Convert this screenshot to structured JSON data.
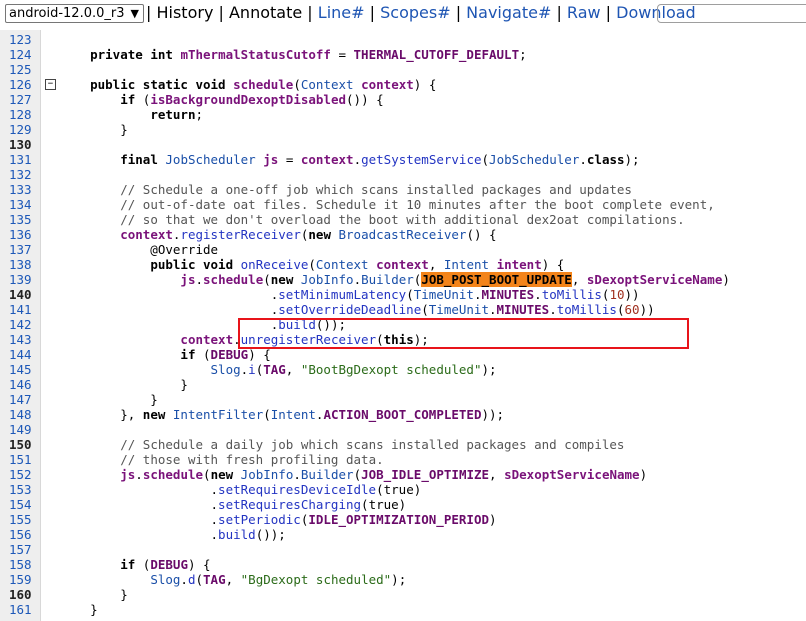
{
  "toolbar": {
    "revision": "android-12.0.0_r3",
    "links": [
      "History",
      "Annotate",
      "Line#",
      "Scopes#",
      "Navigate#",
      "Raw",
      "Download"
    ],
    "search_placeholder": ""
  },
  "code": {
    "lines": [
      {
        "n": "123",
        "text": ""
      },
      {
        "n": "124",
        "text": "    private int mThermalStatusCutoff = THERMAL_CUTOFF_DEFAULT;"
      },
      {
        "n": "125",
        "text": ""
      },
      {
        "n": "126",
        "text": "    public static void schedule(Context context) {"
      },
      {
        "n": "127",
        "text": "        if (isBackgroundDexoptDisabled()) {"
      },
      {
        "n": "128",
        "text": "            return;"
      },
      {
        "n": "129",
        "text": "        }"
      },
      {
        "n": "130",
        "text": ""
      },
      {
        "n": "131",
        "text": "        final JobScheduler js = context.getSystemService(JobScheduler.class);"
      },
      {
        "n": "132",
        "text": ""
      },
      {
        "n": "133",
        "text": "        // Schedule a one-off job which scans installed packages and updates"
      },
      {
        "n": "134",
        "text": "        // out-of-date oat files. Schedule it 10 minutes after the boot complete event,"
      },
      {
        "n": "135",
        "text": "        // so that we don't overload the boot with additional dex2oat compilations."
      },
      {
        "n": "136",
        "text": "        context.registerReceiver(new BroadcastReceiver() {"
      },
      {
        "n": "137",
        "text": "            @Override"
      },
      {
        "n": "138",
        "text": "            public void onReceive(Context context, Intent intent) {"
      },
      {
        "n": "139",
        "text": "                js.schedule(new JobInfo.Builder(JOB_POST_BOOT_UPDATE, sDexoptServiceName)"
      },
      {
        "n": "140",
        "text": "                            .setMinimumLatency(TimeUnit.MINUTES.toMillis(10))"
      },
      {
        "n": "141",
        "text": "                            .setOverrideDeadline(TimeUnit.MINUTES.toMillis(60))"
      },
      {
        "n": "142",
        "text": "                            .build());"
      },
      {
        "n": "143",
        "text": "                context.unregisterReceiver(this);"
      },
      {
        "n": "144",
        "text": "                if (DEBUG) {"
      },
      {
        "n": "145",
        "text": "                    Slog.i(TAG, \"BootBgDexopt scheduled\");"
      },
      {
        "n": "146",
        "text": "                }"
      },
      {
        "n": "147",
        "text": "            }"
      },
      {
        "n": "148",
        "text": "        }, new IntentFilter(Intent.ACTION_BOOT_COMPLETED));"
      },
      {
        "n": "149",
        "text": ""
      },
      {
        "n": "150",
        "text": "        // Schedule a daily job which scans installed packages and compiles"
      },
      {
        "n": "151",
        "text": "        // those with fresh profiling data."
      },
      {
        "n": "152",
        "text": "        js.schedule(new JobInfo.Builder(JOB_IDLE_OPTIMIZE, sDexoptServiceName)"
      },
      {
        "n": "153",
        "text": "                    .setRequiresDeviceIdle(true)"
      },
      {
        "n": "154",
        "text": "                    .setRequiresCharging(true)"
      },
      {
        "n": "155",
        "text": "                    .setPeriodic(IDLE_OPTIMIZATION_PERIOD)"
      },
      {
        "n": "156",
        "text": "                    .build());"
      },
      {
        "n": "157",
        "text": ""
      },
      {
        "n": "158",
        "text": "        if (DEBUG) {"
      },
      {
        "n": "159",
        "text": "            Slog.d(TAG, \"BgDexopt scheduled\");"
      },
      {
        "n": "160",
        "text": "        }"
      },
      {
        "n": "161",
        "text": "    }"
      }
    ],
    "bold_line_numbers": [
      "130",
      "140",
      "150",
      "160"
    ],
    "highlighted_symbol": "JOB_POST_BOOT_UPDATE",
    "fold_marker_line": "126",
    "fold_marker_glyph": "−"
  },
  "colors": {
    "highlight": "#f3841a",
    "box": "#e8141a",
    "link": "#1e55b3"
  }
}
